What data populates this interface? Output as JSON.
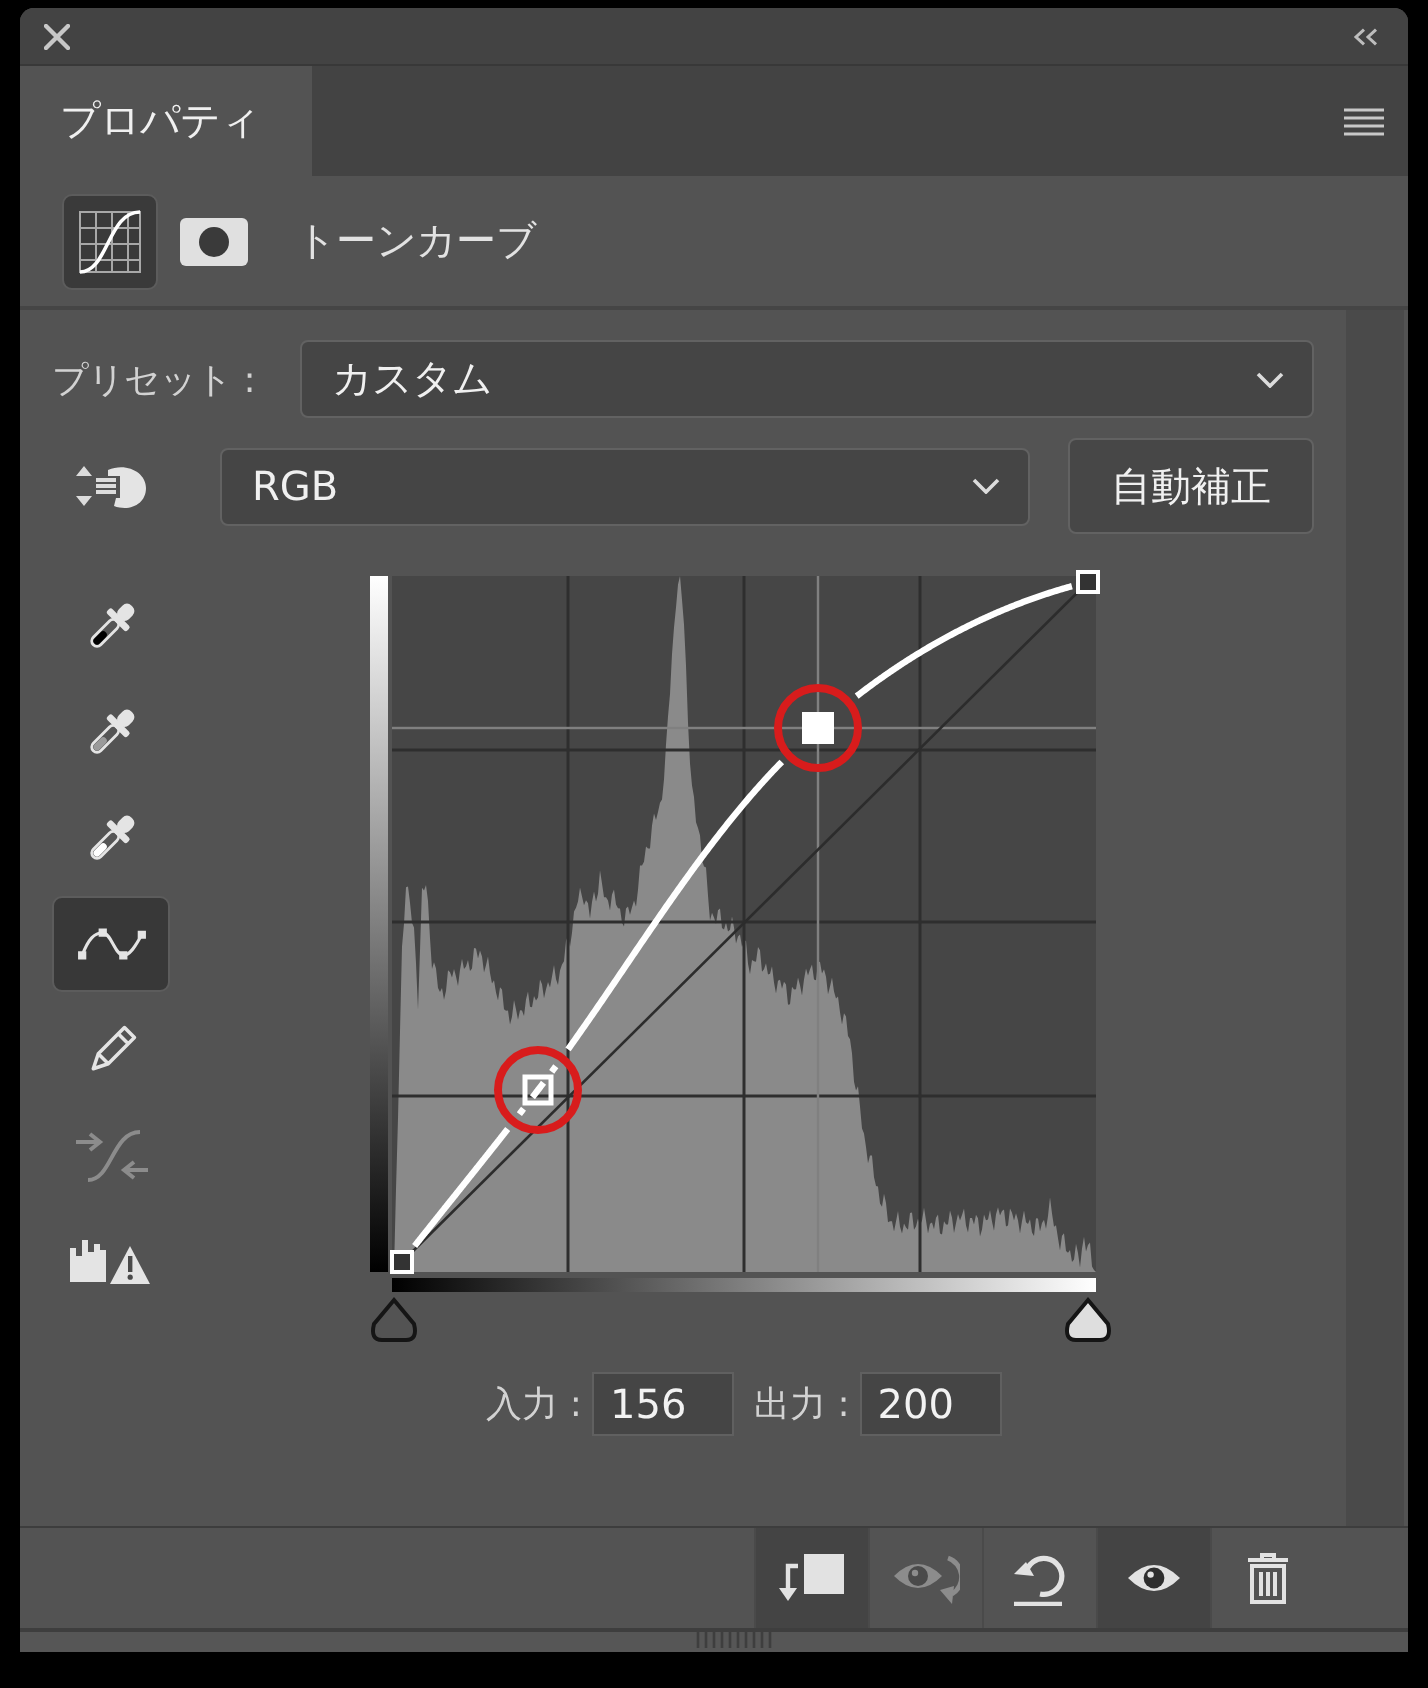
{
  "tabs": [
    {
      "label": "プロパティ",
      "selected": true
    }
  ],
  "adjustment": {
    "title": "トーンカーブ",
    "modes": [
      {
        "kind": "curves",
        "selected": true
      },
      {
        "kind": "mask",
        "selected": false
      }
    ]
  },
  "preset": {
    "label": "プリセット :",
    "value": "カスタム"
  },
  "channel": {
    "value": "RGB"
  },
  "auto_button": {
    "label": "自動補正"
  },
  "tools": [
    {
      "kind": "eyedropper-black",
      "selected": false,
      "disabled": false
    },
    {
      "kind": "eyedropper-gray",
      "selected": false,
      "disabled": false
    },
    {
      "kind": "eyedropper-white",
      "selected": false,
      "disabled": false
    },
    {
      "kind": "points",
      "selected": true,
      "disabled": false
    },
    {
      "kind": "pencil",
      "selected": false,
      "disabled": false
    },
    {
      "kind": "smooth",
      "selected": false,
      "disabled": true
    },
    {
      "kind": "clipping",
      "selected": false,
      "disabled": false
    }
  ],
  "curve": {
    "points": [
      {
        "kind": "end",
        "selected": false,
        "highlighted": false
      },
      {
        "kind": "point",
        "selected": false,
        "highlighted": true
      },
      {
        "kind": "point",
        "selected": true,
        "highlighted": true
      },
      {
        "kind": "end",
        "selected": false,
        "highlighted": false
      }
    ]
  },
  "input_sliders": [
    {
      "kind": "shadows",
      "level": 0
    },
    {
      "kind": "highlights",
      "level": 1
    }
  ],
  "input": {
    "label": "入力 :",
    "value": "156"
  },
  "output": {
    "label": "出力 :",
    "value": "200"
  },
  "footer_buttons": [
    {
      "kind": "clip",
      "on": true,
      "disabled": false
    },
    {
      "kind": "view-previous",
      "on": false,
      "disabled": true
    },
    {
      "kind": "reset",
      "on": false,
      "disabled": false
    },
    {
      "kind": "visibility",
      "on": true,
      "disabled": false
    },
    {
      "kind": "delete",
      "on": false,
      "disabled": false
    }
  ]
}
